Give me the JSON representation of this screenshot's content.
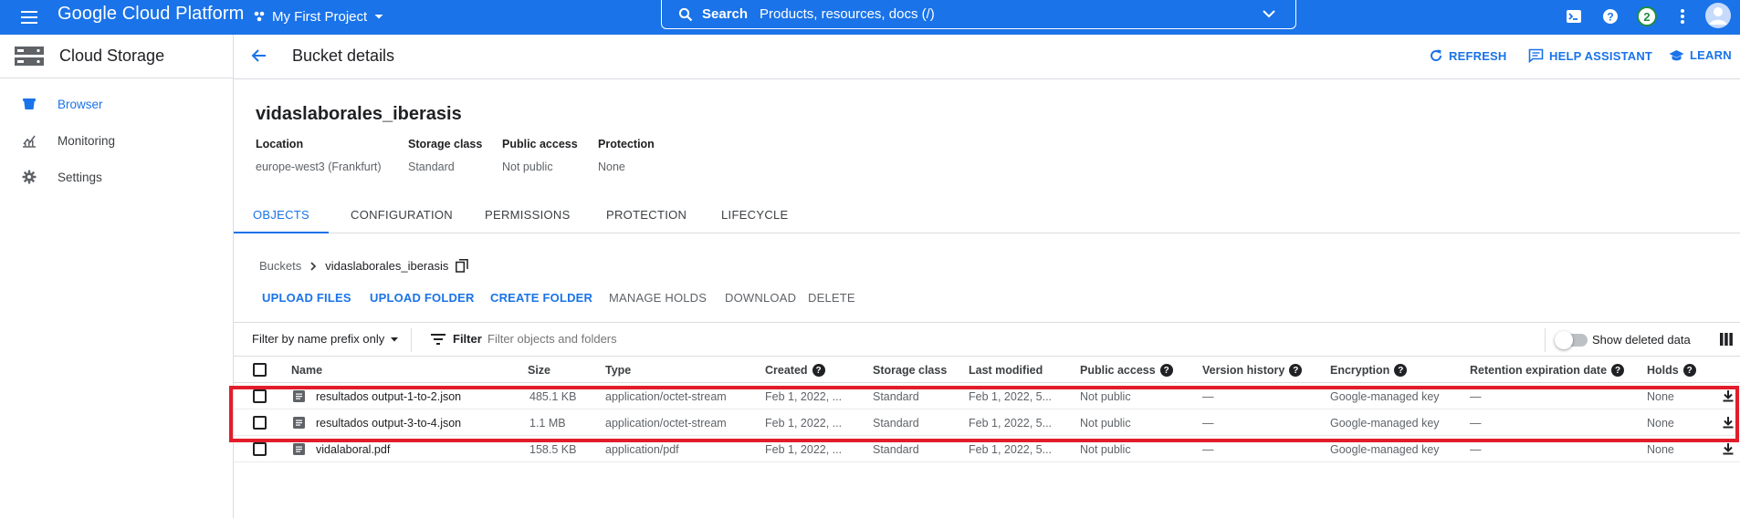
{
  "topbar": {
    "brand": "Google Cloud Platform",
    "project": "My First Project",
    "search_label": "Search",
    "search_placeholder": "Products, resources, docs (/)",
    "notification_count": "2",
    "brand_color": "#1a73e8"
  },
  "leftnav": {
    "title": "Cloud Storage",
    "items": [
      {
        "label": "Browser",
        "icon": "bucket-icon",
        "active": true
      },
      {
        "label": "Monitoring",
        "icon": "monitoring-icon",
        "active": false
      },
      {
        "label": "Settings",
        "icon": "gear-icon",
        "active": false
      }
    ]
  },
  "header": {
    "title": "Bucket details",
    "refresh": "REFRESH",
    "help": "HELP ASSISTANT",
    "learn": "LEARN"
  },
  "bucket": {
    "name": "vidaslaborales_iberasis",
    "meta": [
      {
        "label": "Location",
        "value": "europe-west3 (Frankfurt)"
      },
      {
        "label": "Storage class",
        "value": "Standard"
      },
      {
        "label": "Public access",
        "value": "Not public"
      },
      {
        "label": "Protection",
        "value": "None"
      }
    ]
  },
  "tabs": [
    {
      "label": "OBJECTS",
      "active": true
    },
    {
      "label": "CONFIGURATION",
      "active": false
    },
    {
      "label": "PERMISSIONS",
      "active": false
    },
    {
      "label": "PROTECTION",
      "active": false
    },
    {
      "label": "LIFECYCLE",
      "active": false
    }
  ],
  "breadcrumb": {
    "root": "Buckets",
    "current": "vidaslaborales_iberasis"
  },
  "actions": [
    {
      "label": "UPLOAD FILES",
      "enabled": true
    },
    {
      "label": "UPLOAD FOLDER",
      "enabled": true
    },
    {
      "label": "CREATE FOLDER",
      "enabled": true
    },
    {
      "label": "MANAGE HOLDS",
      "enabled": false
    },
    {
      "label": "DOWNLOAD",
      "enabled": false
    },
    {
      "label": "DELETE",
      "enabled": false
    }
  ],
  "filterbar": {
    "prefix_select": "Filter by name prefix only",
    "filter_label": "Filter",
    "filter_placeholder": "Filter objects and folders",
    "show_deleted": "Show deleted data"
  },
  "table": {
    "columns": [
      "Name",
      "Size",
      "Type",
      "Created",
      "Storage class",
      "Last modified",
      "Public access",
      "Version history",
      "Encryption",
      "Retention expiration date",
      "Holds"
    ],
    "rows": [
      {
        "name": "resultados output-1-to-2.json",
        "size": "485.1 KB",
        "type": "application/octet-stream",
        "created": "Feb 1, 2022, ...",
        "storage_class": "Standard",
        "last_modified": "Feb 1, 2022, 5...",
        "public_access": "Not public",
        "version_history": "—",
        "encryption": "Google-managed key",
        "retention": "—",
        "holds": "None"
      },
      {
        "name": "resultados output-3-to-4.json",
        "size": "1.1 MB",
        "type": "application/octet-stream",
        "created": "Feb 1, 2022, ...",
        "storage_class": "Standard",
        "last_modified": "Feb 1, 2022, 5...",
        "public_access": "Not public",
        "version_history": "—",
        "encryption": "Google-managed key",
        "retention": "—",
        "holds": "None"
      },
      {
        "name": "vidalaboral.pdf",
        "size": "158.5 KB",
        "type": "application/pdf",
        "created": "Feb 1, 2022, ...",
        "storage_class": "Standard",
        "last_modified": "Feb 1, 2022, 5...",
        "public_access": "Not public",
        "version_history": "—",
        "encryption": "Google-managed key",
        "retention": "—",
        "holds": "None"
      }
    ]
  },
  "annotation_color": "#e21d2b"
}
